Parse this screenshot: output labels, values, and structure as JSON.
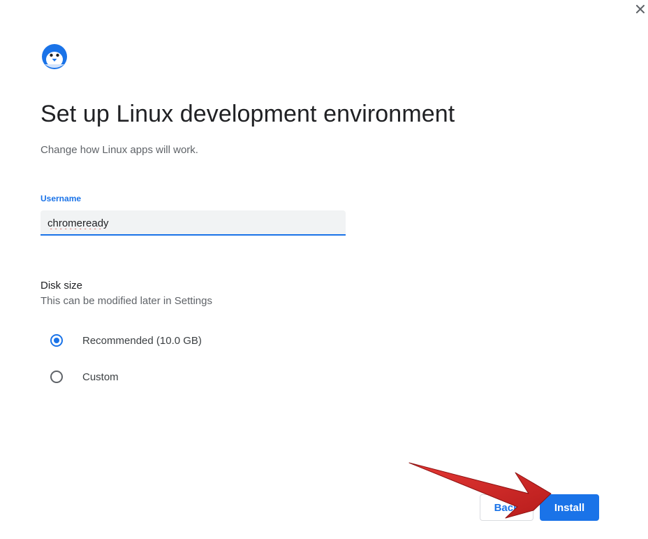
{
  "dialog": {
    "title": "Set up Linux development environment",
    "subtitle": "Change how Linux apps will work.",
    "close_icon": "close-icon",
    "logo_icon": "penguin-logo-icon"
  },
  "username": {
    "label": "Username",
    "value": "chromeready"
  },
  "disk": {
    "title": "Disk size",
    "subtitle": "This can be modified later in Settings",
    "options": [
      {
        "label": "Recommended (10.0 GB)",
        "selected": true
      },
      {
        "label": "Custom",
        "selected": false
      }
    ]
  },
  "buttons": {
    "back_label": "Back",
    "install_label": "Install"
  },
  "colors": {
    "accent": "#1a73e8",
    "annotation_arrow": "#d91c1c"
  }
}
